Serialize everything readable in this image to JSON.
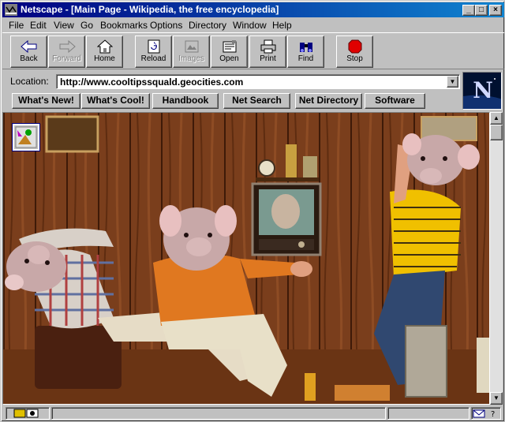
{
  "window": {
    "title": "Netscape - [Main Page - Wikipedia, the free encyclopedia]",
    "controls": {
      "minimize": "_",
      "maximize": "□",
      "close": "×"
    }
  },
  "menu": [
    "File",
    "Edit",
    "View",
    "Go",
    "Bookmarks",
    "Options",
    "Directory",
    "Window",
    "Help"
  ],
  "toolbar": {
    "back": "Back",
    "forward": "Forward",
    "home": "Home",
    "reload": "Reload",
    "images": "Images",
    "open": "Open",
    "print": "Print",
    "find": "Find",
    "stop": "Stop"
  },
  "location": {
    "label": "Location:",
    "url": "http://www.cooltipssquald.geocities.com"
  },
  "directory_buttons": [
    "What's New!",
    "What's Cool!",
    "Handbook",
    "Net Search",
    "Net Directory",
    "Software"
  ],
  "throbber": {
    "letter": "N"
  },
  "colors": {
    "titlebar_start": "#000080",
    "titlebar_end": "#1084d0",
    "chrome": "#c0c0c0",
    "stop_red": "#e00000"
  },
  "icons": {
    "back": "arrow-left-icon",
    "forward": "arrow-right-icon",
    "home": "house-icon",
    "reload": "reload-icon",
    "images": "images-icon",
    "open": "open-icon",
    "print": "printer-icon",
    "find": "binoculars-icon",
    "stop": "stop-sign-icon",
    "status_security": "key-icon",
    "status_mail": "mail-icon"
  }
}
